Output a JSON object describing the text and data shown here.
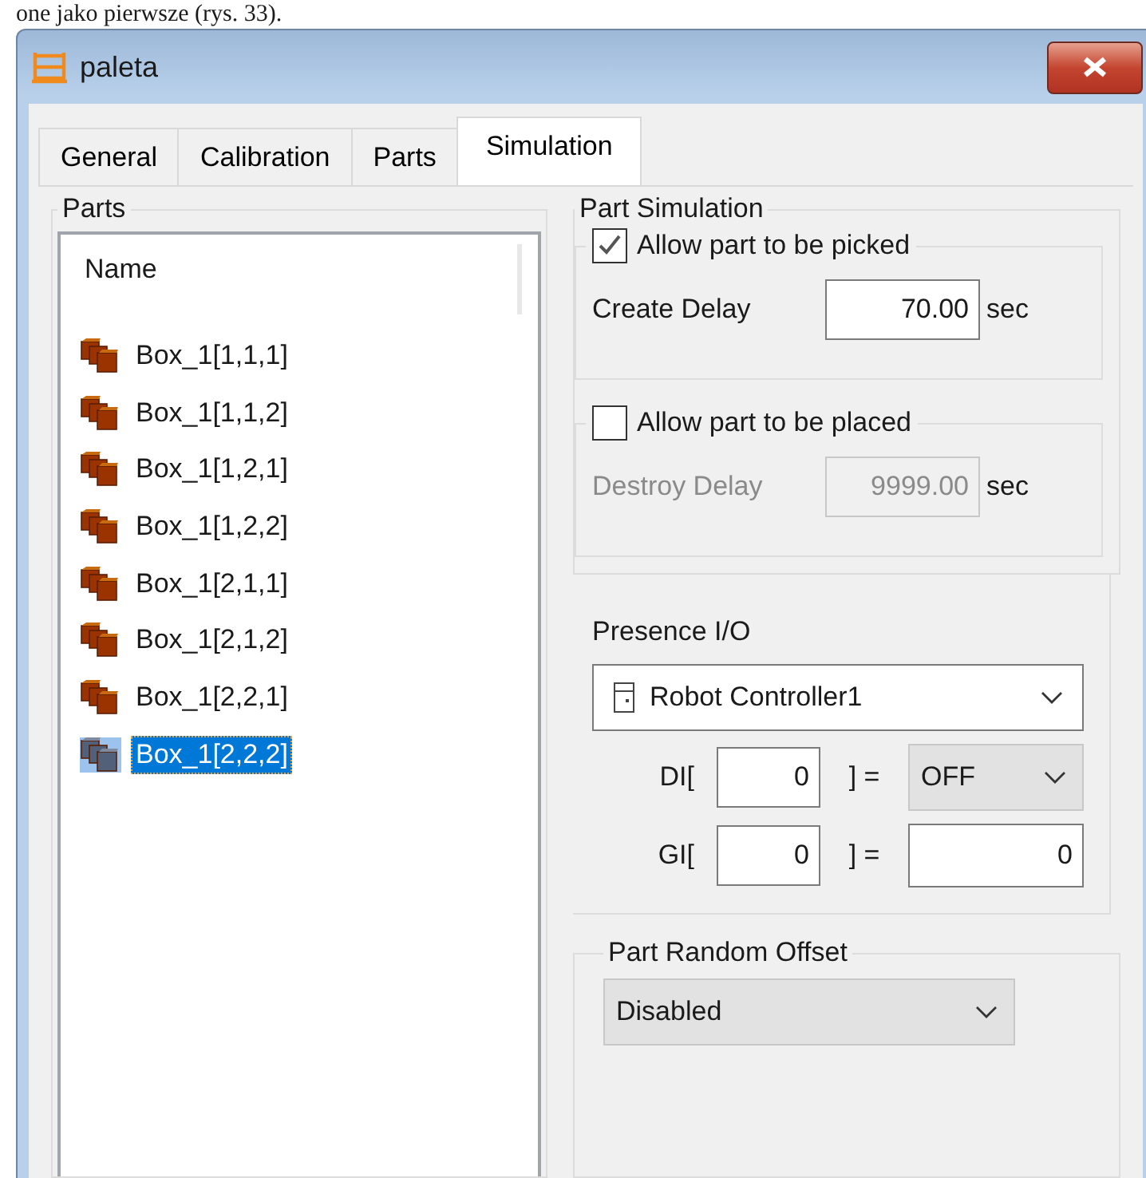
{
  "document_text": "one jako pierwsze (rys. 33).",
  "window": {
    "title": "paleta"
  },
  "tabs": [
    {
      "label": "General",
      "selected": false
    },
    {
      "label": "Calibration",
      "selected": false
    },
    {
      "label": "Parts",
      "selected": false
    },
    {
      "label": "Simulation",
      "selected": true
    }
  ],
  "parts": {
    "title": "Parts",
    "column": "Name",
    "items": [
      {
        "label": "Box_1[1,1,1]",
        "selected": false
      },
      {
        "label": "Box_1[1,1,2]",
        "selected": false
      },
      {
        "label": "Box_1[1,2,1]",
        "selected": false
      },
      {
        "label": "Box_1[1,2,2]",
        "selected": false
      },
      {
        "label": "Box_1[2,1,1]",
        "selected": false
      },
      {
        "label": "Box_1[2,1,2]",
        "selected": false
      },
      {
        "label": "Box_1[2,2,1]",
        "selected": false
      },
      {
        "label": "Box_1[2,2,2]",
        "selected": true
      }
    ]
  },
  "part_simulation": {
    "title": "Part Simulation",
    "options": [
      {
        "label": "Allow part to be picked",
        "checked": true,
        "delay_label": "Create Delay",
        "delay": "70.00",
        "unit": "sec"
      },
      {
        "label": "Allow part to be placed",
        "checked": false,
        "delay_label": "Destroy Delay",
        "delay": "9999.00",
        "unit": "sec"
      }
    ]
  },
  "presence_io": {
    "title": "Presence I/O",
    "controller": "Robot Controller1",
    "rows": [
      {
        "kind": "dropdown",
        "label": "DI[",
        "index": "0",
        "equals": "] =",
        "value": "OFF"
      },
      {
        "kind": "field",
        "label": "GI[",
        "index": "0",
        "equals": "] =",
        "value": "0"
      }
    ]
  },
  "random_offset": {
    "title": "Part Random Offset",
    "mode": "Disabled"
  }
}
